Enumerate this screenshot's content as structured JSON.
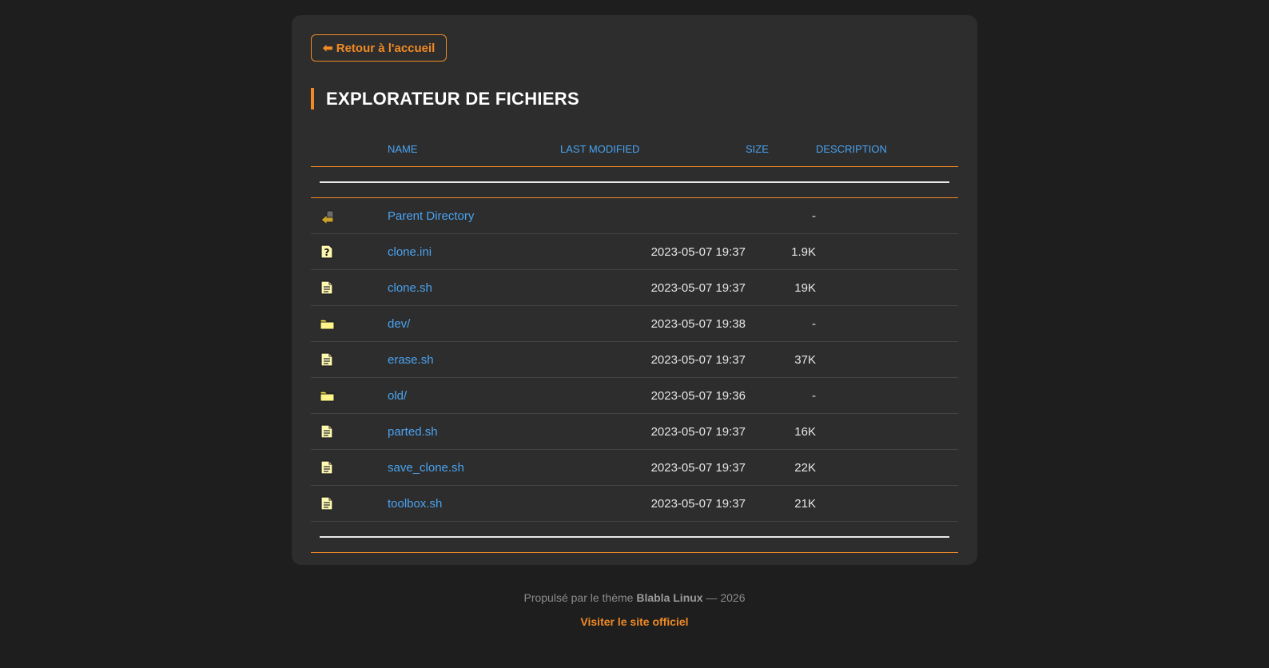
{
  "back_button": {
    "label": "⬅ Retour à l'accueil"
  },
  "page_title": "EXPLORATEUR DE FICHIERS",
  "table": {
    "headers": {
      "name": "Name",
      "last_modified": "Last modified",
      "size": "Size",
      "description": "Description"
    },
    "rows": [
      {
        "icon": "back-arrow-icon",
        "name": "Parent Directory",
        "modified": "",
        "size": "-",
        "description": ""
      },
      {
        "icon": "unknown-file-icon",
        "name": "clone.ini",
        "modified": "2023-05-07 19:37",
        "size": "1.9K",
        "description": ""
      },
      {
        "icon": "text-file-icon",
        "name": "clone.sh",
        "modified": "2023-05-07 19:37",
        "size": "19K",
        "description": ""
      },
      {
        "icon": "folder-icon",
        "name": "dev/",
        "modified": "2023-05-07 19:38",
        "size": "-",
        "description": ""
      },
      {
        "icon": "text-file-icon",
        "name": "erase.sh",
        "modified": "2023-05-07 19:37",
        "size": "37K",
        "description": ""
      },
      {
        "icon": "folder-icon",
        "name": "old/",
        "modified": "2023-05-07 19:36",
        "size": "-",
        "description": ""
      },
      {
        "icon": "text-file-icon",
        "name": "parted.sh",
        "modified": "2023-05-07 19:37",
        "size": "16K",
        "description": ""
      },
      {
        "icon": "text-file-icon",
        "name": "save_clone.sh",
        "modified": "2023-05-07 19:37",
        "size": "22K",
        "description": ""
      },
      {
        "icon": "text-file-icon",
        "name": "toolbox.sh",
        "modified": "2023-05-07 19:37",
        "size": "21K",
        "description": ""
      }
    ]
  },
  "footer": {
    "prefix": "Propulsé par le thème",
    "theme_name": "Blabla Linux",
    "suffix": "— 2026",
    "link_label": "Visiter le site officiel"
  },
  "colors": {
    "accent": "#f08a24",
    "link": "#4aa3f0",
    "background": "#1e1e1e",
    "card": "#2d2d2d"
  }
}
